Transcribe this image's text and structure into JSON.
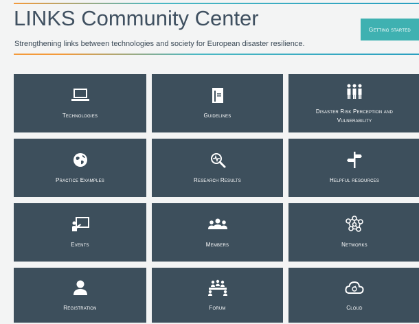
{
  "header": {
    "title": "LINKS Community Center",
    "subtitle": "Strengthening links between technologies and society for European disaster resilience.",
    "cta_label": "Getting started"
  },
  "tiles": [
    {
      "label": "Technologies",
      "icon": "laptop-icon"
    },
    {
      "label": "Guidelines",
      "icon": "document-icon"
    },
    {
      "label": "Disaster Risk Perception and Vulnerability",
      "icon": "people-group-icon"
    },
    {
      "label": "Practice Examples",
      "icon": "globe-icon"
    },
    {
      "label": "Research Results",
      "icon": "magnifier-icon"
    },
    {
      "label": "Helpful resources",
      "icon": "signpost-icon"
    },
    {
      "label": "Events",
      "icon": "presentation-icon"
    },
    {
      "label": "Members",
      "icon": "members-icon"
    },
    {
      "label": "Networks",
      "icon": "network-icon"
    },
    {
      "label": "Registration",
      "icon": "user-icon"
    },
    {
      "label": "Forum",
      "icon": "forum-icon"
    },
    {
      "label": "Cloud",
      "icon": "cloud-icon"
    }
  ],
  "colors": {
    "tile_bg": "#3d4f5c",
    "accent": "#3fb1b1",
    "orange": "#f39a3b",
    "page_bg": "#f3f4f4"
  }
}
